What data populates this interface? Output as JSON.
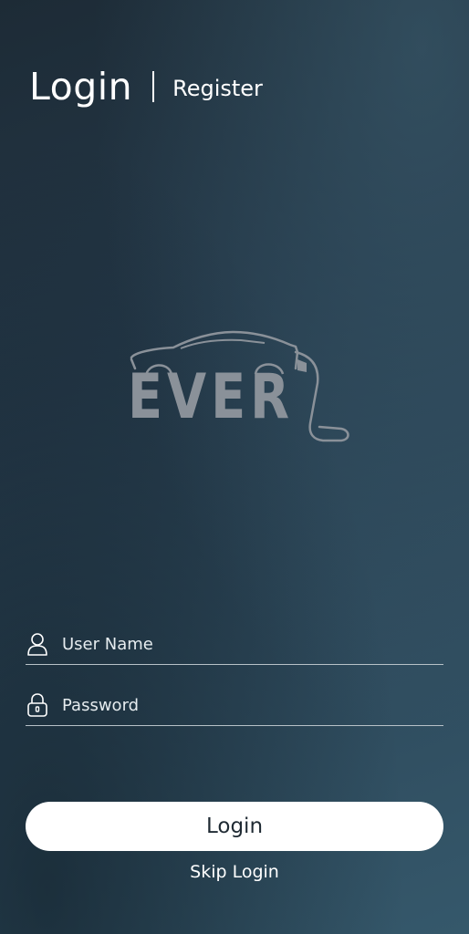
{
  "tabs": {
    "login_label": "Login",
    "register_label": "Register"
  },
  "logo": {
    "wordmark": "EVER",
    "icon": "electric-car-plug-logo"
  },
  "form": {
    "username": {
      "placeholder": "User Name",
      "value": "",
      "icon": "user-icon"
    },
    "password": {
      "placeholder": "Password",
      "value": "",
      "icon": "lock-icon"
    }
  },
  "actions": {
    "login_label": "Login",
    "skip_label": "Skip Login"
  },
  "colors": {
    "background_dark": "#1d2b36",
    "background_light": "#35586b",
    "logo_gray": "#8a9199",
    "button_bg": "#ffffff",
    "button_text": "#1f2a33"
  }
}
